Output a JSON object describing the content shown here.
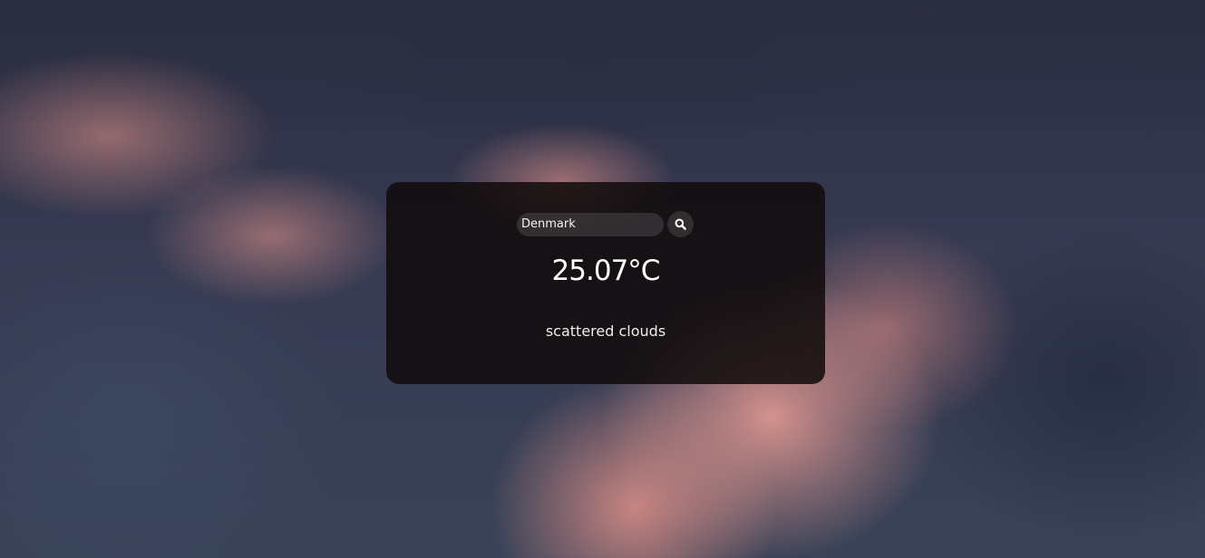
{
  "weather": {
    "search": {
      "value": "Denmark"
    },
    "search_icon": "magnifier-icon",
    "temperature": "25.07°C",
    "description": "scattered clouds"
  },
  "colors": {
    "card_background": "#100a0a",
    "text": "#ffffff"
  }
}
